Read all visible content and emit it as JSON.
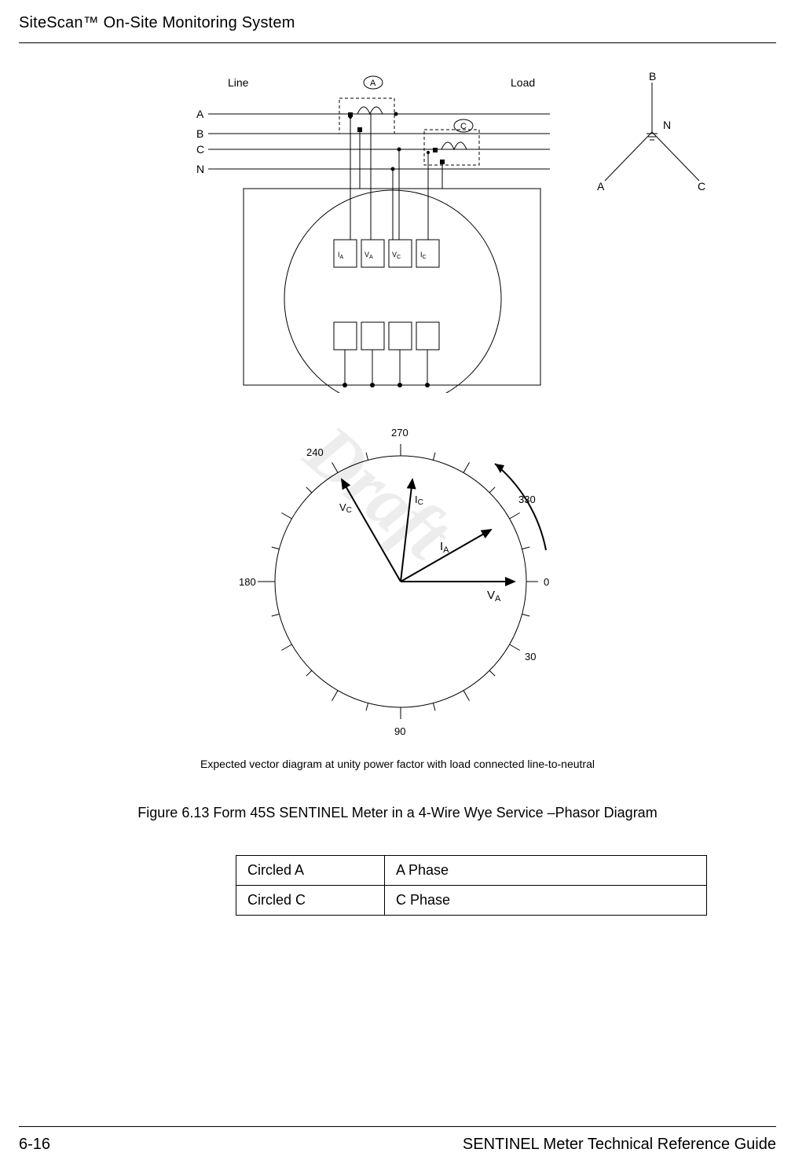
{
  "header": {
    "title_left": "SiteScan™ On-Site Monitoring System"
  },
  "footer": {
    "page_num": "6-16",
    "guide_title": "SENTINEL Meter Technical Reference Guide"
  },
  "watermark": "Draft",
  "wiring": {
    "line_label": "Line",
    "load_label": "Load",
    "lines": [
      "A",
      "B",
      "C",
      "N"
    ],
    "ct_a": "A",
    "ct_c": "C",
    "terminals": [
      "IA",
      "VA",
      "VC",
      "IC"
    ]
  },
  "wye": {
    "a": "A",
    "b": "B",
    "c": "C",
    "n": "N"
  },
  "phasor": {
    "ticks": {
      "t0": "0",
      "t30": "30",
      "t90": "90",
      "t180": "180",
      "t240": "240",
      "t270": "270",
      "t330": "330"
    },
    "vectors": {
      "va": "VA",
      "ia": "IA",
      "vc": "VC",
      "ic": "IC"
    }
  },
  "vector_caption": "Expected vector diagram at unity power factor with load connected line-to-neutral",
  "figure_caption": "Figure 6.13 Form 45S SENTINEL Meter in a 4-Wire Wye Service –Phasor Diagram",
  "legend": [
    {
      "key": "Circled A",
      "val": "A Phase"
    },
    {
      "key": "Circled C",
      "val": "C Phase"
    }
  ],
  "chart_data": {
    "type": "phasor",
    "title": "Expected vector diagram at unity power factor with load connected line-to-neutral",
    "angle_unit": "degrees (clockwise from 0 on right)",
    "radial_ticks": [
      0,
      30,
      60,
      90,
      120,
      150,
      180,
      210,
      240,
      270,
      300,
      330
    ],
    "labeled_ticks": [
      0,
      30,
      90,
      180,
      240,
      270,
      330
    ],
    "vectors": [
      {
        "name": "VA",
        "angle_deg": 0,
        "magnitude": 1.0
      },
      {
        "name": "IA",
        "angle_deg": 330,
        "magnitude": 0.8
      },
      {
        "name": "VC",
        "angle_deg": 240,
        "magnitude": 1.0
      },
      {
        "name": "IC",
        "angle_deg": 275,
        "magnitude": 0.8
      }
    ],
    "rotation_arc": {
      "start_deg": 330,
      "end_deg": 300,
      "direction": "counterclockwise"
    }
  }
}
